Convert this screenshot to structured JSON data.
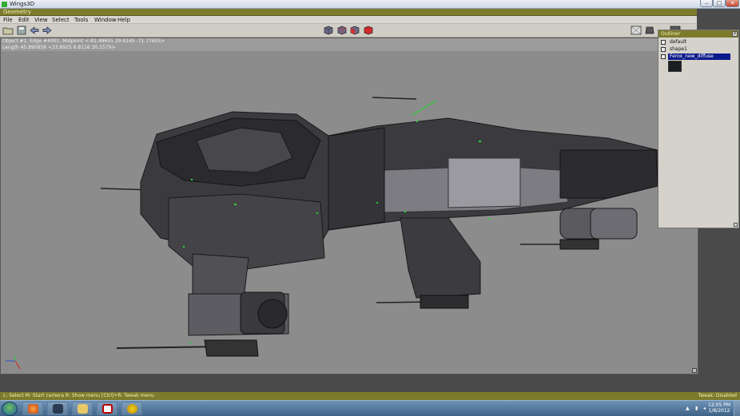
{
  "window": {
    "title": "Wings3D",
    "controls": {
      "minimize": "–",
      "maximize": "□",
      "close": "✕"
    }
  },
  "geometry_bar": {
    "label": "Geometry"
  },
  "menu": [
    "File",
    "Edit",
    "View",
    "Select",
    "Tools",
    "Window",
    "Help"
  ],
  "info": {
    "line1": "Object #1, Edge #4001, Midpoint <-81.49655  29.6145  -71.77655>",
    "line2": "Length 45.890856  <33.8925  6.8116  30.1579>"
  },
  "outliner": {
    "title": "Outliner",
    "close": "x",
    "items": [
      {
        "label": "default",
        "icon": "material-icon"
      },
      {
        "label": "shape1",
        "icon": "object-icon"
      },
      {
        "label": "Ferox_new_diffuse",
        "icon": "image-icon",
        "selected": true
      }
    ]
  },
  "status": {
    "left": "L: Select   M: Start camera   R: Show menu   [Ctrl]+R: Tweak menu",
    "right": "Tweak: Disabled"
  },
  "taskbar": {
    "apps": [
      "firefox-icon",
      "wings3d-icon",
      "explorer-icon",
      "media-icon",
      "app-icon"
    ],
    "time": "12:05 PM",
    "date": "1/8/2012"
  },
  "colors": {
    "accent": "#7d7a2c",
    "viewport_bg": "#8c8c8c",
    "selection": "#0b1a8a"
  }
}
